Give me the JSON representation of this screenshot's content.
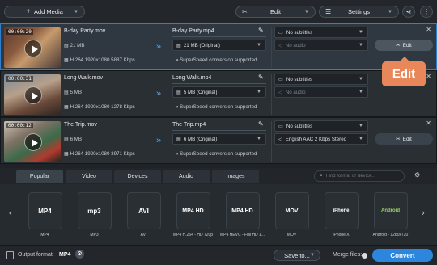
{
  "toolbar": {
    "add_media": "Add Media",
    "edit": "Edit",
    "settings": "Settings"
  },
  "tasks": [
    {
      "time": "00:00:20",
      "src_name": "B-day Party.mov",
      "src_size": "21 MB",
      "src_codec": "H.264 1920x1080 5887 Kbps",
      "out_name": "B-day Party.mp4",
      "out_size": "21 MB (Original)",
      "superspeed": "SuperSpeed conversion supported",
      "subtitles": "No subtitles",
      "audio": "No audio",
      "edit_label": "Edit"
    },
    {
      "time": "00:00:31",
      "src_name": "Long Walk.mov",
      "src_size": "5 MB",
      "src_codec": "H.264 1920x1080 1278 Kbps",
      "out_name": "Long Walk.mp4",
      "out_size": "5 MB (Original)",
      "superspeed": "SuperSpeed conversion supported",
      "subtitles": "No subtitles",
      "audio": "No audio",
      "edit_label": "Edit"
    },
    {
      "time": "00:00:12",
      "src_name": "The Trip.mov",
      "src_size": "6 MB",
      "src_codec": "H.264 1920x1080 3971 Kbps",
      "out_name": "The Trip.mp4",
      "out_size": "6 MB (Original)",
      "superspeed": "SuperSpeed conversion supported",
      "subtitles": "No subtitles",
      "audio": "English AAC 2 Kbps Stereo",
      "edit_label": "Edit"
    }
  ],
  "callout": {
    "label": "Edit",
    "color": "#e8875a"
  },
  "tabs": [
    "Popular",
    "Video",
    "Devices",
    "Audio",
    "Images"
  ],
  "search": {
    "placeholder": "Find format or device..."
  },
  "formats": [
    {
      "icon": "MP4",
      "label": "MP4"
    },
    {
      "icon": "mp3",
      "label": "MP3"
    },
    {
      "icon": "AVI",
      "label": "AVI"
    },
    {
      "icon": "MP4 HD",
      "label": "MP4 H.264 - HD 720p"
    },
    {
      "icon": "MP4 HD",
      "label": "MP4 HEVC - Full HD 1..."
    },
    {
      "icon": "MOV",
      "label": "MOV"
    },
    {
      "icon": "iPhone",
      "label": "iPhone X"
    },
    {
      "icon": "Android",
      "label": "Android - 1280x720"
    }
  ],
  "footer": {
    "output_label": "Output format:",
    "output_value": "MP4",
    "save_to": "Save to...",
    "merge_files": "Merge files:",
    "convert": "Convert"
  },
  "colors": {
    "accent": "#2f7fcf",
    "convert": "#2d86de",
    "callout": "#e8875a"
  }
}
